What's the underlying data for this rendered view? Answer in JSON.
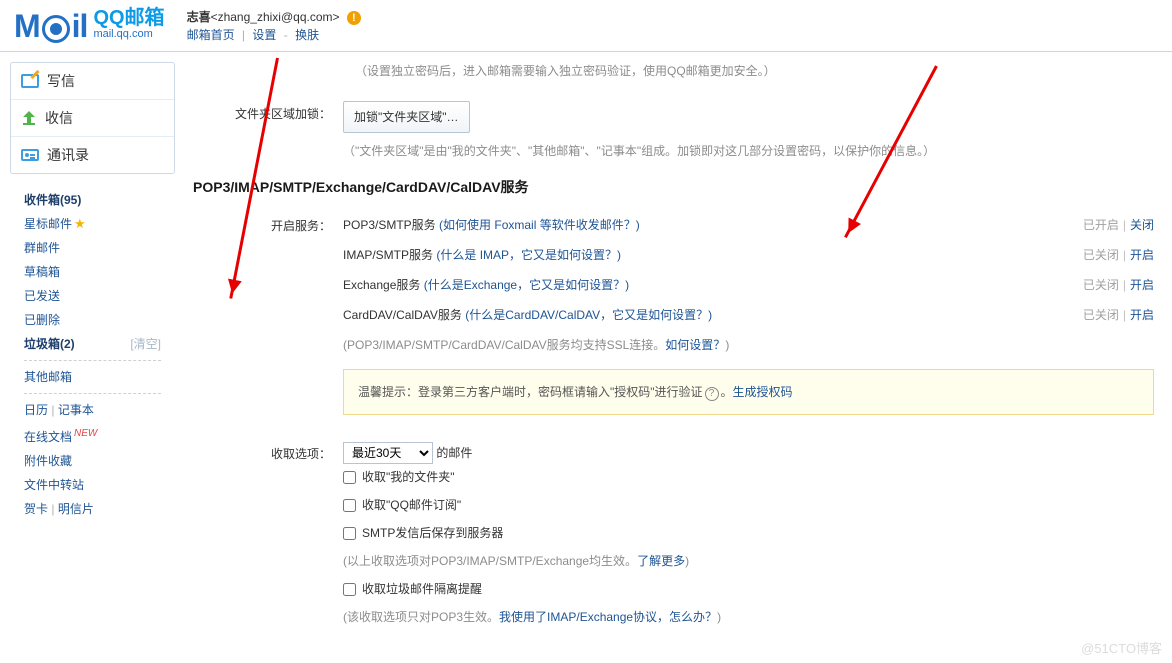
{
  "header": {
    "logo_cn": "QQ邮箱",
    "logo_en": "mail.qq.com",
    "user_name": "志喜",
    "user_email": "<zhang_zhixi@qq.com>",
    "nav_home": "邮箱首页",
    "nav_settings": "设置",
    "nav_skin": "换肤"
  },
  "sidebar": {
    "write": "写信",
    "receive": "收信",
    "contacts": "通讯录",
    "inbox": "收件箱(95)",
    "starred": "星标邮件",
    "group": "群邮件",
    "draft": "草稿箱",
    "sent": "已发送",
    "deleted": "已删除",
    "trash": "垃圾箱(2)",
    "trash_clear": "[清空]",
    "other": "其他邮箱",
    "calendar": "日历",
    "notepad": "记事本",
    "docs": "在线文档",
    "attach": "附件收藏",
    "transfer": "文件中转站",
    "card": "贺卡",
    "postcard": "明信片"
  },
  "content": {
    "top_note": "（设置独立密码后，进入邮箱需要输入独立密码验证，使用QQ邮箱更加安全。）",
    "lock_label": "文件夹区域加锁：",
    "lock_btn": "加锁\"文件夹区域\"…",
    "lock_note": "（\"文件夹区域\"是由\"我的文件夹\"、\"其他邮箱\"、\"记事本\"组成。加锁即对这几部分设置密码，以保护你的信息。）",
    "svc_title": "POP3/IMAP/SMTP/Exchange/CardDAV/CalDAV服务",
    "svc_label": "开启服务：",
    "svc": [
      {
        "name": "POP3/SMTP服务",
        "help": "(如何使用 Foxmail 等软件收发邮件？)",
        "status": "已开启",
        "action": "关闭"
      },
      {
        "name": "IMAP/SMTP服务",
        "help": "(什么是 IMAP，它又是如何设置？)",
        "status": "已关闭",
        "action": "开启"
      },
      {
        "name": "Exchange服务",
        "help": "(什么是Exchange，它又是如何设置？)",
        "status": "已关闭",
        "action": "开启"
      },
      {
        "name": "CardDAV/CalDAV服务",
        "help": "(什么是CardDAV/CalDAV，它又是如何设置？)",
        "status": "已关闭",
        "action": "开启"
      }
    ],
    "ssl_note_pre": "(POP3/IMAP/SMTP/CardDAV/CalDAV服务均支持SSL连接。",
    "ssl_note_link": "如何设置？",
    "ssl_note_post": ")",
    "notice_pre": "温馨提示：登录第三方客户端时，密码框请输入\"授权码\"进行验证",
    "notice_link": "生成授权码",
    "recv_label": "收取选项：",
    "recv_range": "最近30天",
    "recv_suffix": "的邮件",
    "chk1": "收取\"我的文件夹\"",
    "chk2": "收取\"QQ邮件订阅\"",
    "chk3": "SMTP发信后保存到服务器",
    "chk3_note_pre": "(以上收取选项对POP3/IMAP/SMTP/Exchange均生效。",
    "chk3_note_link": "了解更多",
    "chk3_note_post": ")",
    "chk4": "收取垃圾邮件隔离提醒",
    "chk4_note_pre": "(该收取选项只对POP3生效。",
    "chk4_note_link": "我使用了IMAP/Exchange协议，怎么办？",
    "chk4_note_post": ")"
  },
  "watermark": "@51CTO博客"
}
